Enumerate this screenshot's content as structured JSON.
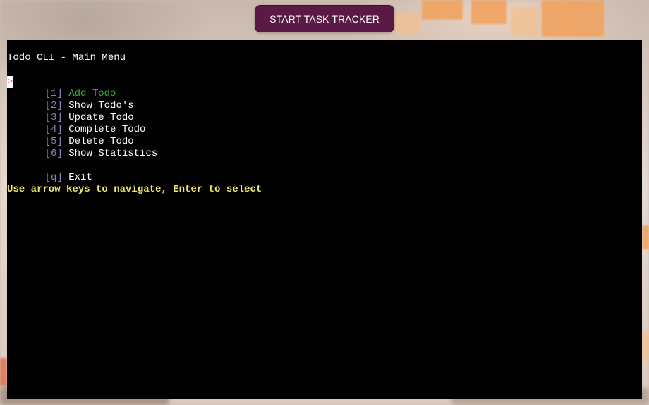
{
  "header": {
    "start_button_label": "START TASK TRACKER"
  },
  "terminal": {
    "title": "Todo CLI - Main Menu",
    "cursor_glyph": ">",
    "menu": [
      {
        "key": "[1]",
        "label": "Add Todo",
        "selected": true
      },
      {
        "key": "[2]",
        "label": "Show Todo's"
      },
      {
        "key": "[3]",
        "label": "Update Todo"
      },
      {
        "key": "[4]",
        "label": "Complete Todo"
      },
      {
        "key": "[5]",
        "label": "Delete Todo"
      },
      {
        "key": "[6]",
        "label": "Show Statistics"
      }
    ],
    "exit": {
      "key": "[q]",
      "label": "Exit"
    },
    "hint": "Use arrow keys to navigate, Enter to select"
  },
  "colors": {
    "button_bg": "#5a1a45",
    "selected_item": "#3ea83e",
    "key_bracket": "#8a7fb8",
    "hint": "#f1e66b",
    "terminal_bg": "#000000"
  }
}
